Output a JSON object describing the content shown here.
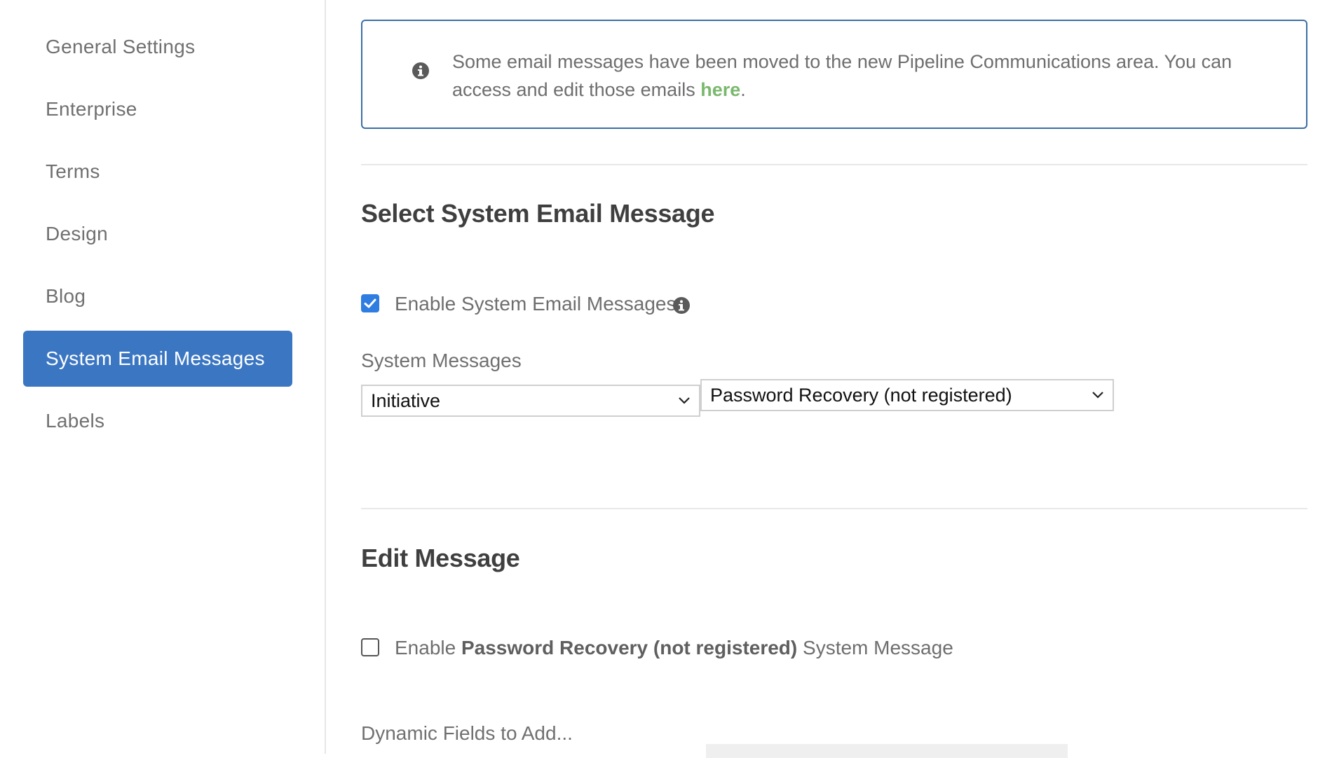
{
  "sidebar": {
    "items": [
      {
        "label": "General Settings"
      },
      {
        "label": "Enterprise"
      },
      {
        "label": "Terms"
      },
      {
        "label": "Design"
      },
      {
        "label": "Blog"
      },
      {
        "label": "System Email Messages",
        "active": true
      },
      {
        "label": "Labels"
      }
    ]
  },
  "notice": {
    "icon": "info-icon",
    "text": "Some email messages have been moved to the new Pipeline Communications area. You can access and edit those emails ",
    "link_label": "here",
    "trailing": "."
  },
  "select_section": {
    "title": "Select System Email Message",
    "enable_label": "Enable System Email Messages",
    "enable_checked": true,
    "info_icon": "info-icon",
    "system_messages_label": "System Messages",
    "category_select": {
      "value": "Initiative"
    },
    "message_select": {
      "value": "Password Recovery (not registered)"
    }
  },
  "edit_section": {
    "title": "Edit Message",
    "enable_prefix": "Enable ",
    "enable_bold": "Password Recovery (not registered)",
    "enable_suffix": " System Message",
    "enable_checked": false,
    "dynamic_fields_label": "Dynamic Fields to Add..."
  },
  "colors": {
    "accent": "#3b76c2",
    "link": "#7ab86c",
    "checkbox": "#2f7de1",
    "notice_border": "#3b6fa5"
  }
}
